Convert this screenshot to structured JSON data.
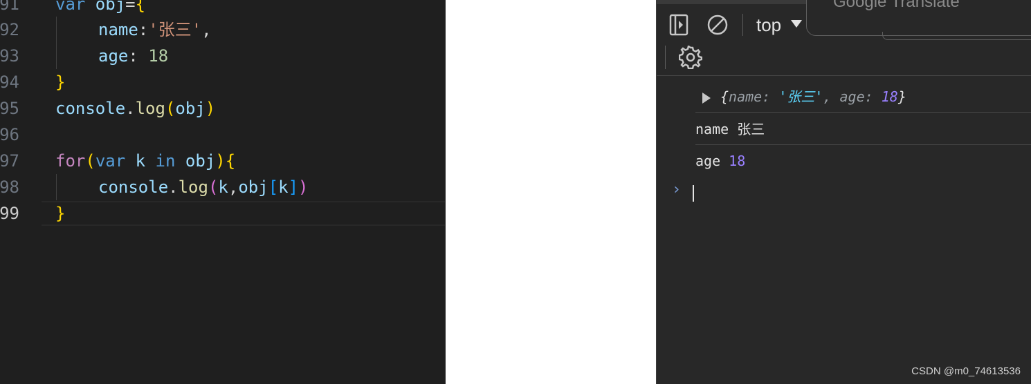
{
  "editor": {
    "lines": [
      {
        "num": "91",
        "tokens": [
          "var",
          " obj",
          "=",
          "{"
        ]
      },
      {
        "num": "92",
        "tokens": [
          "name",
          ":",
          "'张三'",
          ","
        ]
      },
      {
        "num": "93",
        "tokens": [
          "age",
          ": ",
          "18"
        ]
      },
      {
        "num": "94",
        "tokens": [
          "}"
        ]
      },
      {
        "num": "95",
        "tokens": [
          "console",
          ".",
          "log",
          "(",
          "obj",
          ")"
        ]
      },
      {
        "num": "96",
        "tokens": []
      },
      {
        "num": "97",
        "tokens": [
          "for",
          "(",
          "var",
          " k ",
          "in",
          " obj",
          ")",
          "{"
        ]
      },
      {
        "num": "98",
        "tokens": [
          "console",
          ".",
          "log",
          "(",
          "k",
          ",",
          "obj",
          "[",
          "k",
          "]",
          ")"
        ]
      },
      {
        "num": "99",
        "tokens": [
          "}"
        ]
      }
    ]
  },
  "devtools": {
    "toolbar": {
      "context_value": "top",
      "translate_popup_title": "Google Translate"
    },
    "console": {
      "object_log": {
        "open": "{",
        "key1": "name",
        "sep1": ": ",
        "val1": "'张三'",
        "comma": ", ",
        "key2": "age",
        "sep2": ": ",
        "val2": "18",
        "close": "}"
      },
      "row2": {
        "key": "name",
        "value": "张三"
      },
      "row3": {
        "key": "age",
        "value": "18"
      },
      "prompt_symbol": "›"
    }
  },
  "watermark": "CSDN @m0_74613536"
}
